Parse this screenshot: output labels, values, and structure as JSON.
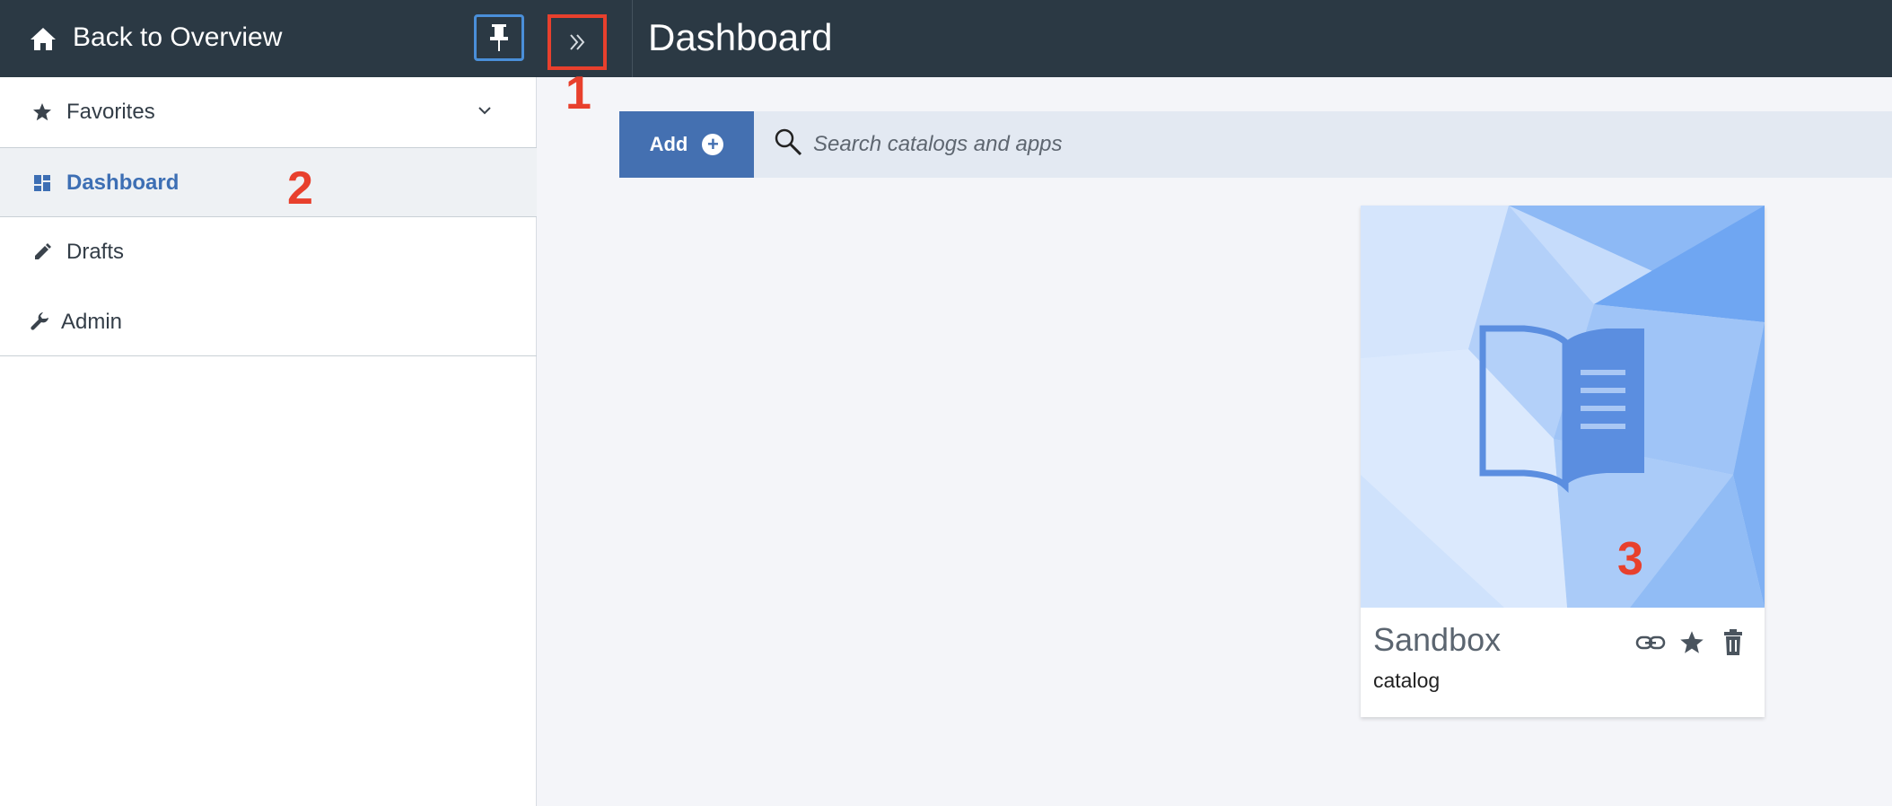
{
  "sidebar": {
    "back_label": "Back to Overview",
    "items": [
      {
        "label": "Favorites",
        "icon": "star-icon"
      },
      {
        "label": "Dashboard",
        "icon": "dashboard-icon"
      },
      {
        "label": "Drafts",
        "icon": "pencil-icon"
      },
      {
        "label": "Admin",
        "icon": "wrench-icon"
      }
    ]
  },
  "header": {
    "title": "Dashboard"
  },
  "toolbar": {
    "add_label": "Add",
    "search_placeholder": "Search catalogs and apps"
  },
  "card": {
    "title": "Sandbox",
    "subtitle": "catalog"
  },
  "annotations": [
    "1",
    "2",
    "3"
  ],
  "colors": {
    "header_bg": "#2b3944",
    "accent": "#4470b1",
    "active_text": "#3d6fb4",
    "annotation": "#e8402d"
  }
}
